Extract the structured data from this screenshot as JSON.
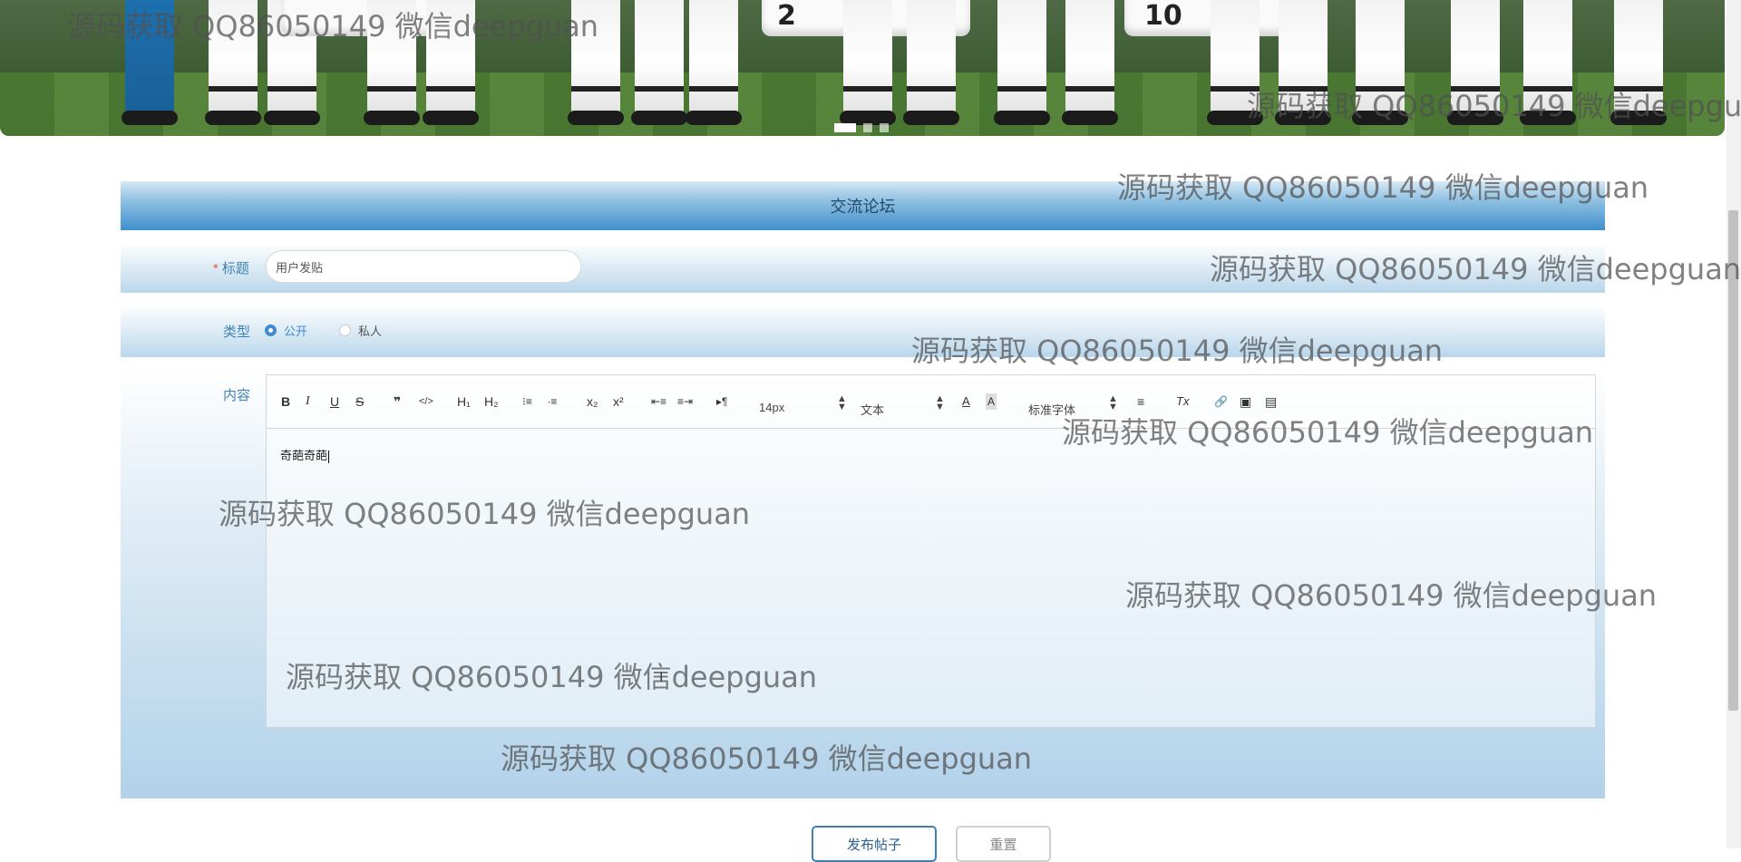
{
  "banner": {
    "jersey_numbers": [
      "2",
      "10"
    ],
    "carousel_dots": 3,
    "active_dot": 0
  },
  "form": {
    "header_title": "交流论坛",
    "title_label": "标题",
    "title_value": "用户发贴",
    "type_label": "类型",
    "type_options": [
      {
        "label": "公开",
        "checked": true
      },
      {
        "label": "私人",
        "checked": false
      }
    ],
    "content_label": "内容",
    "editor": {
      "toolbar": {
        "bold": "B",
        "italic": "I",
        "underline": "U",
        "strike": "S",
        "quote": "❞",
        "code": "</>",
        "h1": "H₁",
        "h2": "H₂",
        "ordered_list": "⁝≡",
        "bullet_list": "∙≡",
        "subscript": "x₂",
        "superscript": "x²",
        "outdent": "⇤≡",
        "indent": "≡⇥",
        "direction": "▸¶",
        "font_size": "14px",
        "header_select": "文本",
        "font_color": "A",
        "background_color": "A",
        "font_family": "标准字体",
        "align": "≡",
        "clean": "Tx",
        "link": "🔗",
        "image": "▣",
        "video": "▤"
      },
      "content": "奇葩奇葩"
    },
    "submit_label": "发布帖子",
    "reset_label": "重置"
  },
  "watermark_text": "源码获取 QQ86050149 微信deepguan",
  "colors": {
    "accent": "#3d8bd0",
    "label": "#3e82b6",
    "header_gradient_end": "#3f8fcc",
    "required": "#e0584c"
  }
}
